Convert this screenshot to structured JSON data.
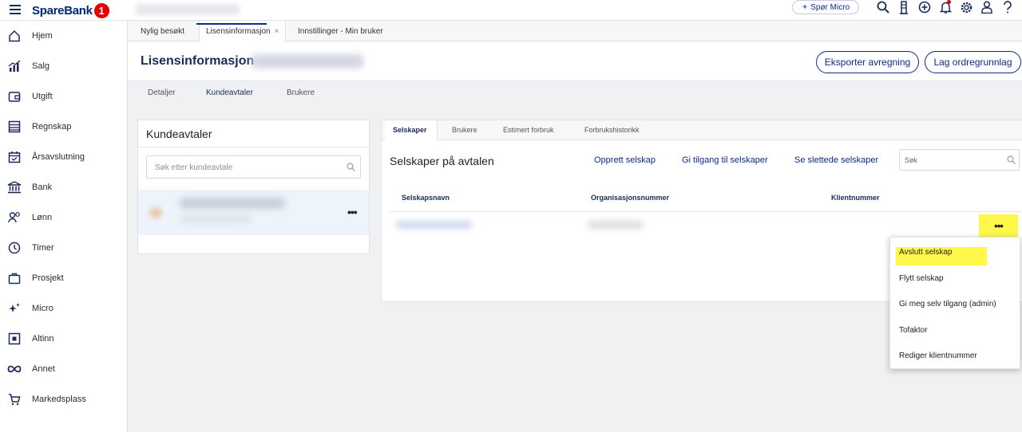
{
  "app": {
    "logo_text": "SpareBank",
    "logo_badge": "1",
    "ask_micro_label": "Spør Micro"
  },
  "topbar_icons": [
    "search-icon",
    "tower-icon",
    "add-icon",
    "bell-icon",
    "gear-icon",
    "user-icon",
    "help-icon"
  ],
  "sidebar": {
    "items": [
      {
        "label": "Hjem",
        "icon": "home-icon"
      },
      {
        "label": "Salg",
        "icon": "sales-icon"
      },
      {
        "label": "Utgift",
        "icon": "wallet-icon"
      },
      {
        "label": "Regnskap",
        "icon": "ledger-icon"
      },
      {
        "label": "Årsavslutning",
        "icon": "calendar-icon"
      },
      {
        "label": "Bank",
        "icon": "bank-icon"
      },
      {
        "label": "Lønn",
        "icon": "payroll-icon"
      },
      {
        "label": "Timer",
        "icon": "clock-icon"
      },
      {
        "label": "Prosjekt",
        "icon": "briefcase-icon"
      },
      {
        "label": "Micro",
        "icon": "sparkle-icon"
      },
      {
        "label": "Altinn",
        "icon": "altinn-icon"
      },
      {
        "label": "Annet",
        "icon": "infinity-icon"
      },
      {
        "label": "Markedsplass",
        "icon": "cart-icon"
      }
    ]
  },
  "doc_tabs": [
    {
      "label": "Nylig besøkt"
    },
    {
      "label": "Lisensinformasjon",
      "close": "×"
    },
    {
      "label": "Innstillinger - Min bruker"
    }
  ],
  "header": {
    "title": "Lisensinformasjon",
    "export_button": "Eksporter avregning",
    "order_button": "Lag ordregrunnlag"
  },
  "subtabs": [
    "Detaljer",
    "Kundeavtaler",
    "Brukere"
  ],
  "left_panel": {
    "title": "Kundeavtaler",
    "search_placeholder": "Søk etter kundeavtale",
    "row_menu": "•••"
  },
  "right_panel": {
    "tabs": [
      "Selskaper",
      "Brukere",
      "Estimert forbruk",
      "Forbrukshistorikk"
    ],
    "title": "Selskaper på avtalen",
    "links": {
      "create": "Opprett selskap",
      "grant": "Gi tilgang til selskaper",
      "deleted": "Se slettede selskaper"
    },
    "search_placeholder": "Søk",
    "columns": [
      "Selskapsnavn",
      "Organisasjonsnummer",
      "Klientnummer"
    ],
    "row_menu": "•••"
  },
  "context_menu": {
    "items": [
      "Avslutt selskap",
      "Flytt selskap",
      "Gi meg selv tilgang (admin)",
      "Tofaktor",
      "Rediger klientnummer"
    ]
  },
  "colors": {
    "brand": "#002776",
    "accent": "#0d2a8c",
    "logo_red": "#e60000",
    "highlight": "#fff84a"
  }
}
